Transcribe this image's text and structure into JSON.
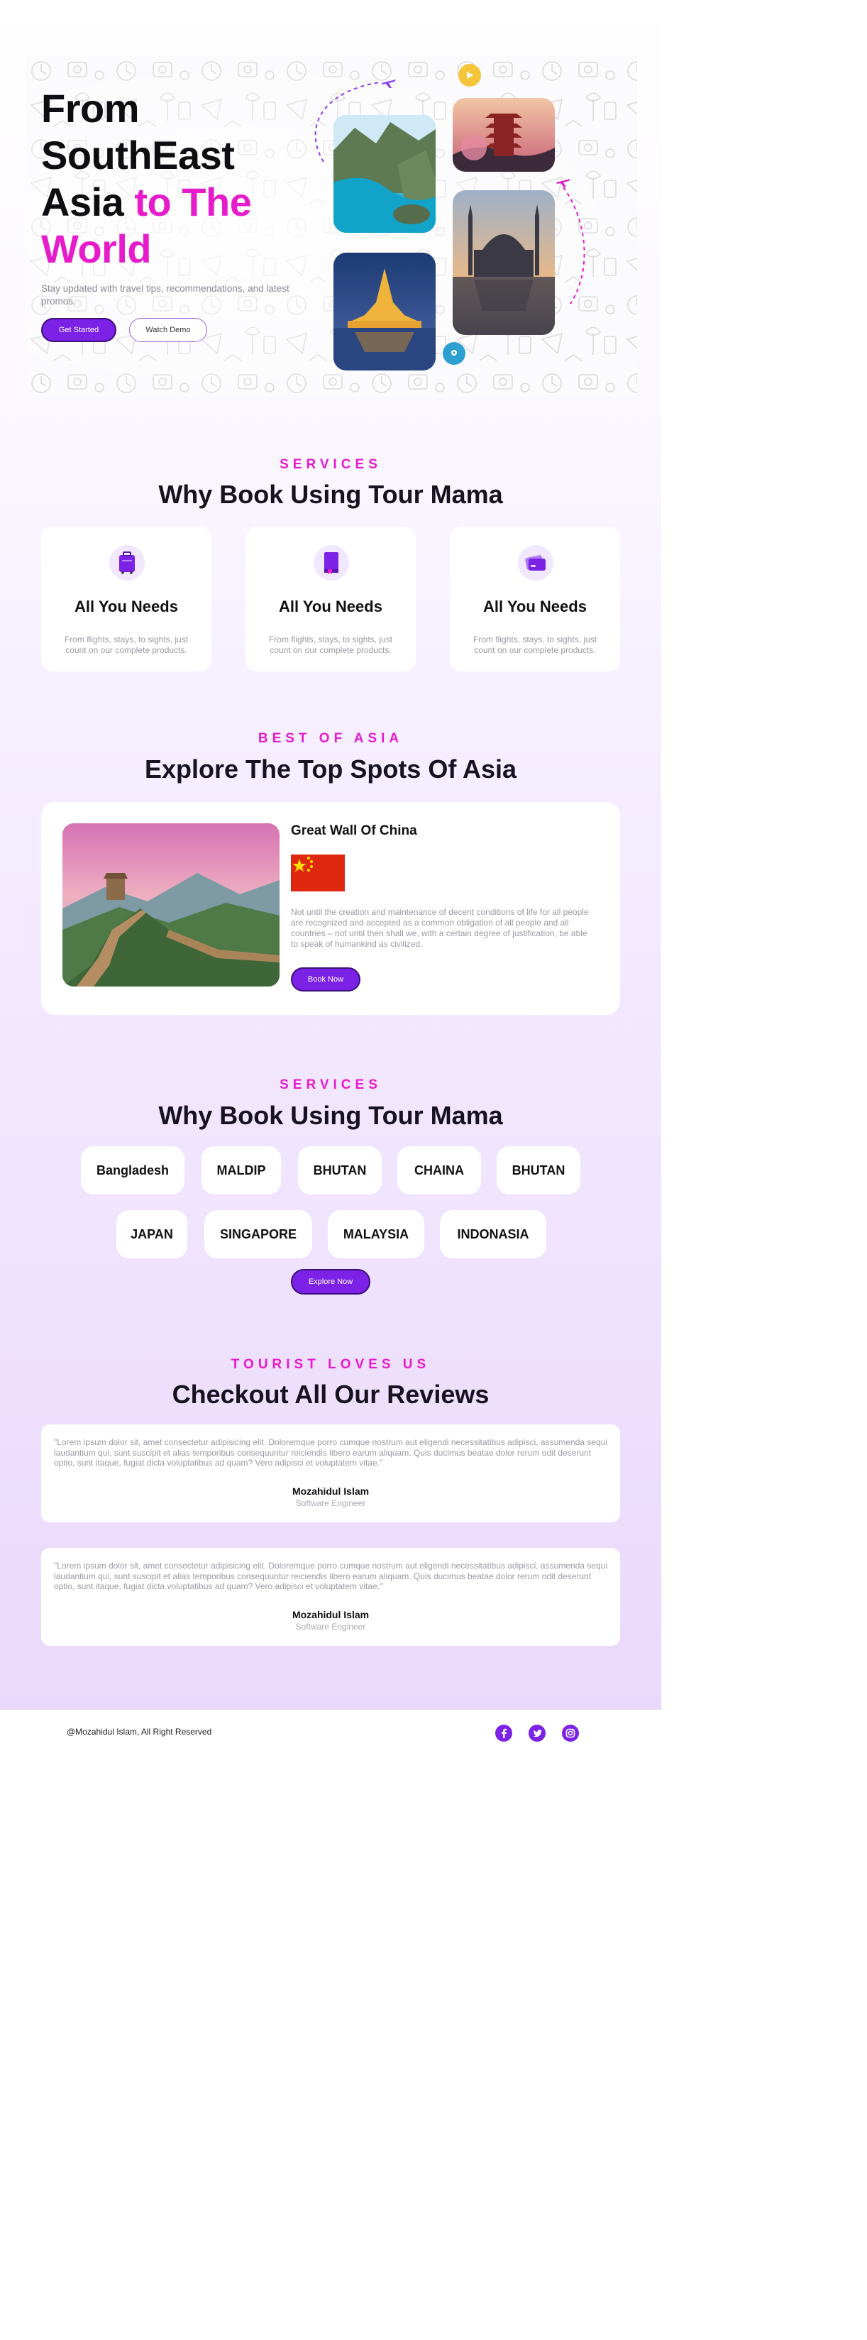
{
  "hero": {
    "title_line1": "From",
    "title_line2": "SouthEast",
    "title_line3_plain": "Asia ",
    "title_line3_accent": "to The",
    "title_line4_accent": "World",
    "subtitle": "Stay updated with travel tips, recommendations, and latest promos.",
    "primary_button": "Get Started",
    "secondary_button": "Watch Demo"
  },
  "services": {
    "eyebrow": "SERVICES",
    "title": "Why Book Using Tour Mama",
    "cards": [
      {
        "icon": "luggage-icon",
        "title": "All You Needs",
        "desc": "From flights, stays, to sights, just count on our complete products."
      },
      {
        "icon": "guide-book-icon",
        "title": "All You Needs",
        "desc": "From flights, stays, to sights, just count on our complete products."
      },
      {
        "icon": "credit-card-icon",
        "title": "All You Needs",
        "desc": "From flights, stays, to sights, just count on our complete products."
      }
    ]
  },
  "spots": {
    "eyebrow": "BEST OF ASIA",
    "title": "Explore The Top Spots Of Asia",
    "card": {
      "title": "Great Wall Of China",
      "flag": "china-flag",
      "desc": "Not until the creation and maintenance of decent conditions of life for all people are recognized and accepted as a common obligation of all people and all countries – not until then shall we, with a certain degree of justification, be able to speak of humankind as civilized.",
      "button": "Book Now"
    }
  },
  "countries": {
    "eyebrow": "SERVICES",
    "title": "Why Book Using Tour Mama",
    "row1": [
      "Bangladesh",
      "MALDIP",
      "BHUTAN",
      "CHAINA",
      "BHUTAN"
    ],
    "row2": [
      "JAPAN",
      "SINGAPORE",
      "MALAYSIA",
      "INDONASIA"
    ],
    "button": "Explore Now"
  },
  "reviews": {
    "eyebrow": "TOURIST LOVES US",
    "title": "Checkout All Our Reviews",
    "items": [
      {
        "text": "\"Lorem ipsum dolor sit, amet consectetur adipisicing elit. Doloremque porro cumque nostrum aut eligendi necessitatibus adipisci, assumenda sequi laudantium qui, sunt suscipit et alias temporibus consequuntur reiciendis libero earum aliquam. Quis ducimus beatae dolor rerum odit deserunt optio, sunt itaque, fugiat dicta voluptatibus ad quam? Vero adipisci et voluptatem vitae.\"",
        "name": "Mozahidul Islam",
        "role": "Software Engineer"
      },
      {
        "text": "\"Lorem ipsum dolor sit, amet consectetur adipisicing elit. Doloremque porro cumque nostrum aut eligendi necessitatibus adipisci, assumenda sequi laudantium qui, sunt suscipit et alias temporibus consequuntur reiciendis libero earum aliquam. Quis ducimus beatae dolor rerum odit deserunt optio, sunt itaque, fugiat dicta voluptatibus ad quam? Vero adipisci et voluptatem vitae.\"",
        "name": "Mozahidul Islam",
        "role": "Software Engineer"
      }
    ]
  },
  "footer": {
    "copyright": "@Mozahidul Islam, All Right Reserved",
    "social": [
      "facebook-icon",
      "twitter-icon",
      "instagram-icon"
    ]
  },
  "colors": {
    "primary": "#7b22e6",
    "accent": "#e61ccb",
    "heading": "#17121f",
    "muted": "#9a9aa3"
  }
}
